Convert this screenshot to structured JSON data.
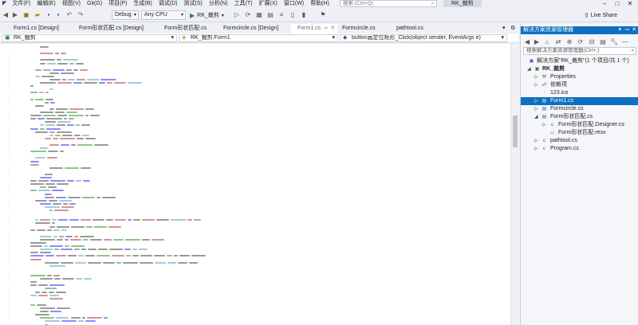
{
  "menu": {
    "items": [
      "文件(F)",
      "编辑(E)",
      "视图(V)",
      "Git(G)",
      "项目(P)",
      "生成(B)",
      "调试(D)",
      "测试(S)",
      "分析(N)",
      "工具(T)",
      "扩展(X)",
      "窗口(W)",
      "帮助(H)"
    ],
    "search_placeholder": "搜索 (Ctrl+Q)",
    "solution_name": "RK_裁剪",
    "live_share": "Live Share"
  },
  "toolbar": {
    "config": "Debug",
    "platform": "Any CPU",
    "start_label": "RK_裁剪"
  },
  "tabs": [
    {
      "label": "Form1.cs [Design]",
      "active": false
    },
    {
      "label": "Form形状匹配.cs [Design]",
      "active": false
    },
    {
      "label": "Form形状匹配.cs",
      "active": false
    },
    {
      "label": "Formcircle.cs [Design]",
      "active": false
    },
    {
      "label": "Form1.cs",
      "active": true
    },
    {
      "label": "Formcircle.cs",
      "active": false
    },
    {
      "label": "pathtool.cs",
      "active": false
    }
  ],
  "navbar": {
    "project": "RK_裁剪",
    "class": "RK_裁剪.Form1",
    "member": "button画定位矩形_Click(object sender, EventArgs e)"
  },
  "solution_explorer": {
    "title": "解决方案资源管理器",
    "search_placeholder": "搜索解决方案资源管理器(Ctrl+;)",
    "solution_label": "解决方案\"RK_裁剪\"(1 个项目/共 1 个)",
    "items": [
      {
        "label": "RK_裁剪",
        "icon": "csharp-project-icon"
      },
      {
        "label": "Properties",
        "icon": "wrench-icon"
      },
      {
        "label": "依赖项",
        "icon": "dependencies-icon"
      },
      {
        "label": "123.ico",
        "icon": "file-icon"
      },
      {
        "label": "Form1.cs",
        "icon": "form-icon"
      },
      {
        "label": "Formcircle.cs",
        "icon": "form-icon"
      },
      {
        "label": "Form形状匹配.cs",
        "icon": "form-icon"
      },
      {
        "label": "Form形状匹配.Designer.cs",
        "icon": "csharp-file-icon"
      },
      {
        "label": "Form形状匹配.resx",
        "icon": "resx-file-icon"
      },
      {
        "label": "pathtool.cs",
        "icon": "csharp-file-icon"
      },
      {
        "label": "Program.cs",
        "icon": "csharp-file-icon"
      }
    ]
  },
  "colors": {
    "accent": "#0e70c0",
    "keyword": "#0000ff",
    "type": "#2b91af",
    "string": "#a31515",
    "comment": "#008000",
    "text": "#1e1e1e"
  }
}
